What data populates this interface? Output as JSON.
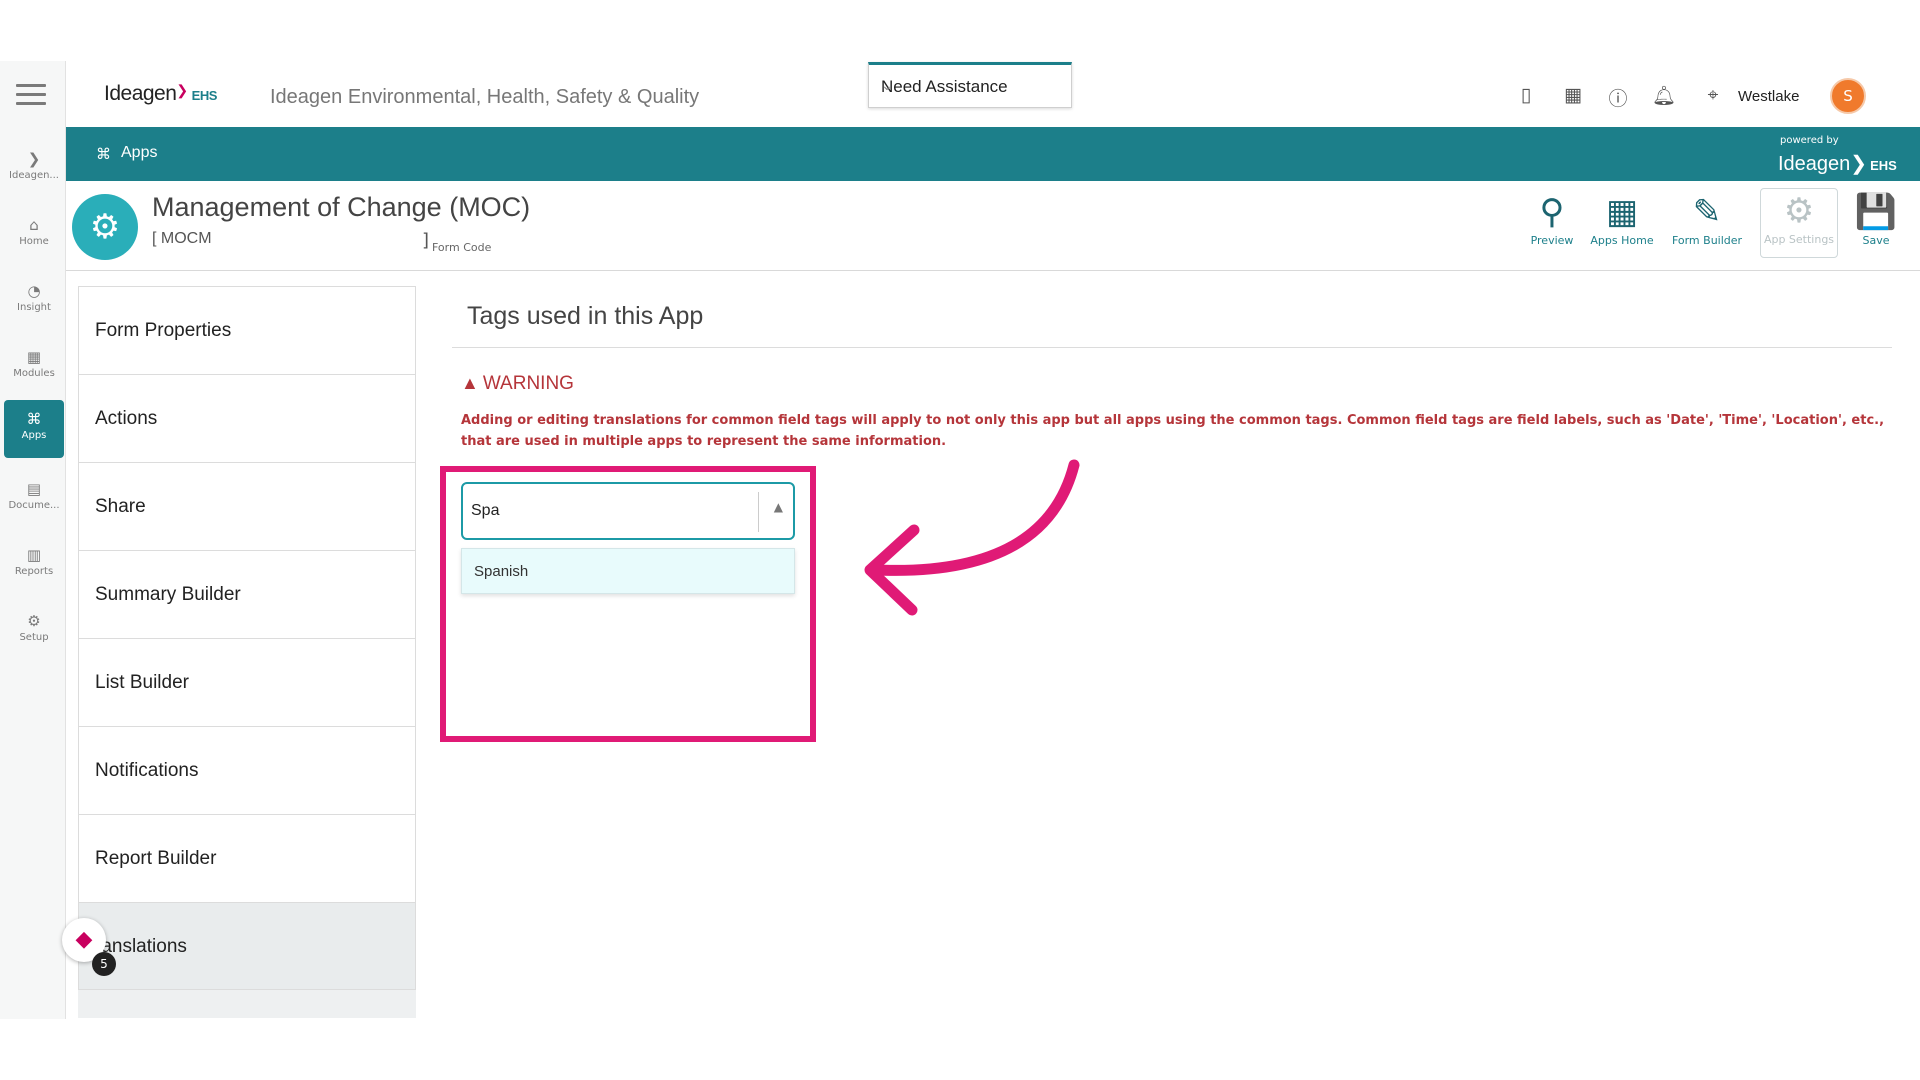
{
  "rail": {
    "items": [
      {
        "label": "Ideagen...",
        "icon": "ideagen-icon",
        "glyph": "❯"
      },
      {
        "label": "Home",
        "icon": "home-icon",
        "glyph": "⌂"
      },
      {
        "label": "Insight",
        "icon": "pie-chart-icon",
        "glyph": "◔"
      },
      {
        "label": "Modules",
        "icon": "grid-icon",
        "glyph": "▦"
      },
      {
        "label": "Apps",
        "icon": "apps-icon",
        "glyph": "⌘"
      },
      {
        "label": "Docume...",
        "icon": "document-icon",
        "glyph": "▤"
      },
      {
        "label": "Reports",
        "icon": "bar-chart-icon",
        "glyph": "▥"
      },
      {
        "label": "Setup",
        "icon": "gear-icon",
        "glyph": "⚙"
      }
    ]
  },
  "header": {
    "logo_text": "Ideagen",
    "logo_suffix": "EHS",
    "app_title": "Ideagen Environmental, Health, Safety & Quality",
    "assist_label": "Need Assistance",
    "user_name": "Westlake",
    "avatar_text": "S"
  },
  "breadcrumb": {
    "label": "Apps",
    "powered_by": "powered by",
    "powered_logo": "Ideagen",
    "powered_suffix": "EHS"
  },
  "app": {
    "name": "Management of Change (MOC)",
    "code": "[ MOCM",
    "code_close": "]",
    "code_label": "Form Code"
  },
  "tools": [
    {
      "label": "Preview",
      "icon": "magnifier-icon",
      "glyph": "⚲"
    },
    {
      "label": "Apps Home",
      "icon": "apps-home-icon",
      "glyph": "▦"
    },
    {
      "label": "Form Builder",
      "icon": "form-builder-icon",
      "glyph": "✎"
    },
    {
      "label": "App Settings",
      "icon": "gear-icon",
      "glyph": "⚙"
    },
    {
      "label": "Save",
      "icon": "save-icon",
      "glyph": "💾"
    }
  ],
  "menu": {
    "items": [
      "Form Properties",
      "Actions",
      "Share",
      "Summary Builder",
      "List Builder",
      "Notifications",
      "Report Builder",
      "ranslations"
    ],
    "active_index": 7
  },
  "help_badge": {
    "count": "5"
  },
  "content": {
    "title": "Tags used in this App",
    "warning_title": "WARNING",
    "warning_text": "Adding or editing translations for common field tags will apply to not only this app but all apps using the common tags. Common field tags are field labels, such as 'Date', 'Time', 'Location', etc., that are used in multiple apps to represent the same information.",
    "language_input_value": "Spa",
    "dropdown_option": "Spanish"
  },
  "colors": {
    "teal": "#1c7f8a",
    "warning": "#b5353a",
    "highlight": "#e01a76"
  }
}
